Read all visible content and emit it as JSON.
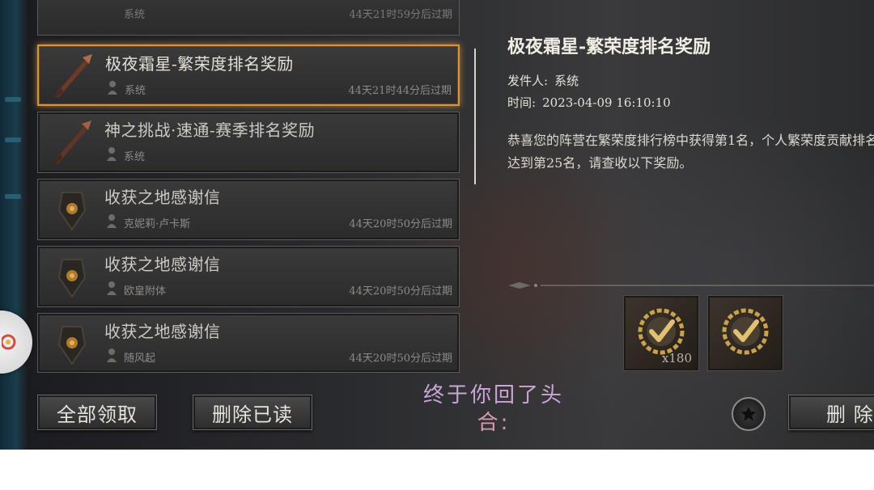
{
  "mail_list": {
    "partial_item": {
      "sender": "系统",
      "expiry": "44天21时59分后过期"
    },
    "items": [
      {
        "title": "极夜霜星-繁荣度排名奖励",
        "sender": "系统",
        "expiry": "44天21时44分后过期",
        "icon": "spear-icon",
        "selected": true
      },
      {
        "title": "神之挑战·速通-赛季排名奖励",
        "sender": "系统",
        "expiry": "",
        "icon": "spear-icon",
        "selected": false
      },
      {
        "title": "收获之地感谢信",
        "sender": "克妮莉·卢卡斯",
        "expiry": "44天20时50分后过期",
        "icon": "shield-emblem-icon",
        "selected": false
      },
      {
        "title": "收获之地感谢信",
        "sender": "欧皇附体",
        "expiry": "44天20时50分后过期",
        "icon": "shield-emblem-icon",
        "selected": false
      },
      {
        "title": "收获之地感谢信",
        "sender": "随风起",
        "expiry": "44天20时50分后过期",
        "icon": "shield-emblem-icon",
        "selected": false
      }
    ]
  },
  "buttons": {
    "collect_all": "全部领取",
    "delete_read": "删除已读",
    "delete": "删 除"
  },
  "detail": {
    "title": "极夜霜星-繁荣度排名奖励",
    "sender_label": "发件人:",
    "sender": "系统",
    "time_label": "时间:",
    "time": "2023-04-09 16:10:10",
    "body": "恭喜您的阵营在繁荣度排行榜中获得第1名，个人繁荣度贡献排名达到第25名，请查收以下奖励。"
  },
  "rewards": [
    {
      "icon": "gold-check-medal-icon",
      "quantity": "x180"
    },
    {
      "icon": "gold-check-medal-icon",
      "quantity": ""
    }
  ],
  "caption": {
    "line1": "终于你回了头",
    "line2": "合:"
  },
  "colors": {
    "selected_border": "#d49440",
    "panel_text": "#e6e0d6"
  }
}
